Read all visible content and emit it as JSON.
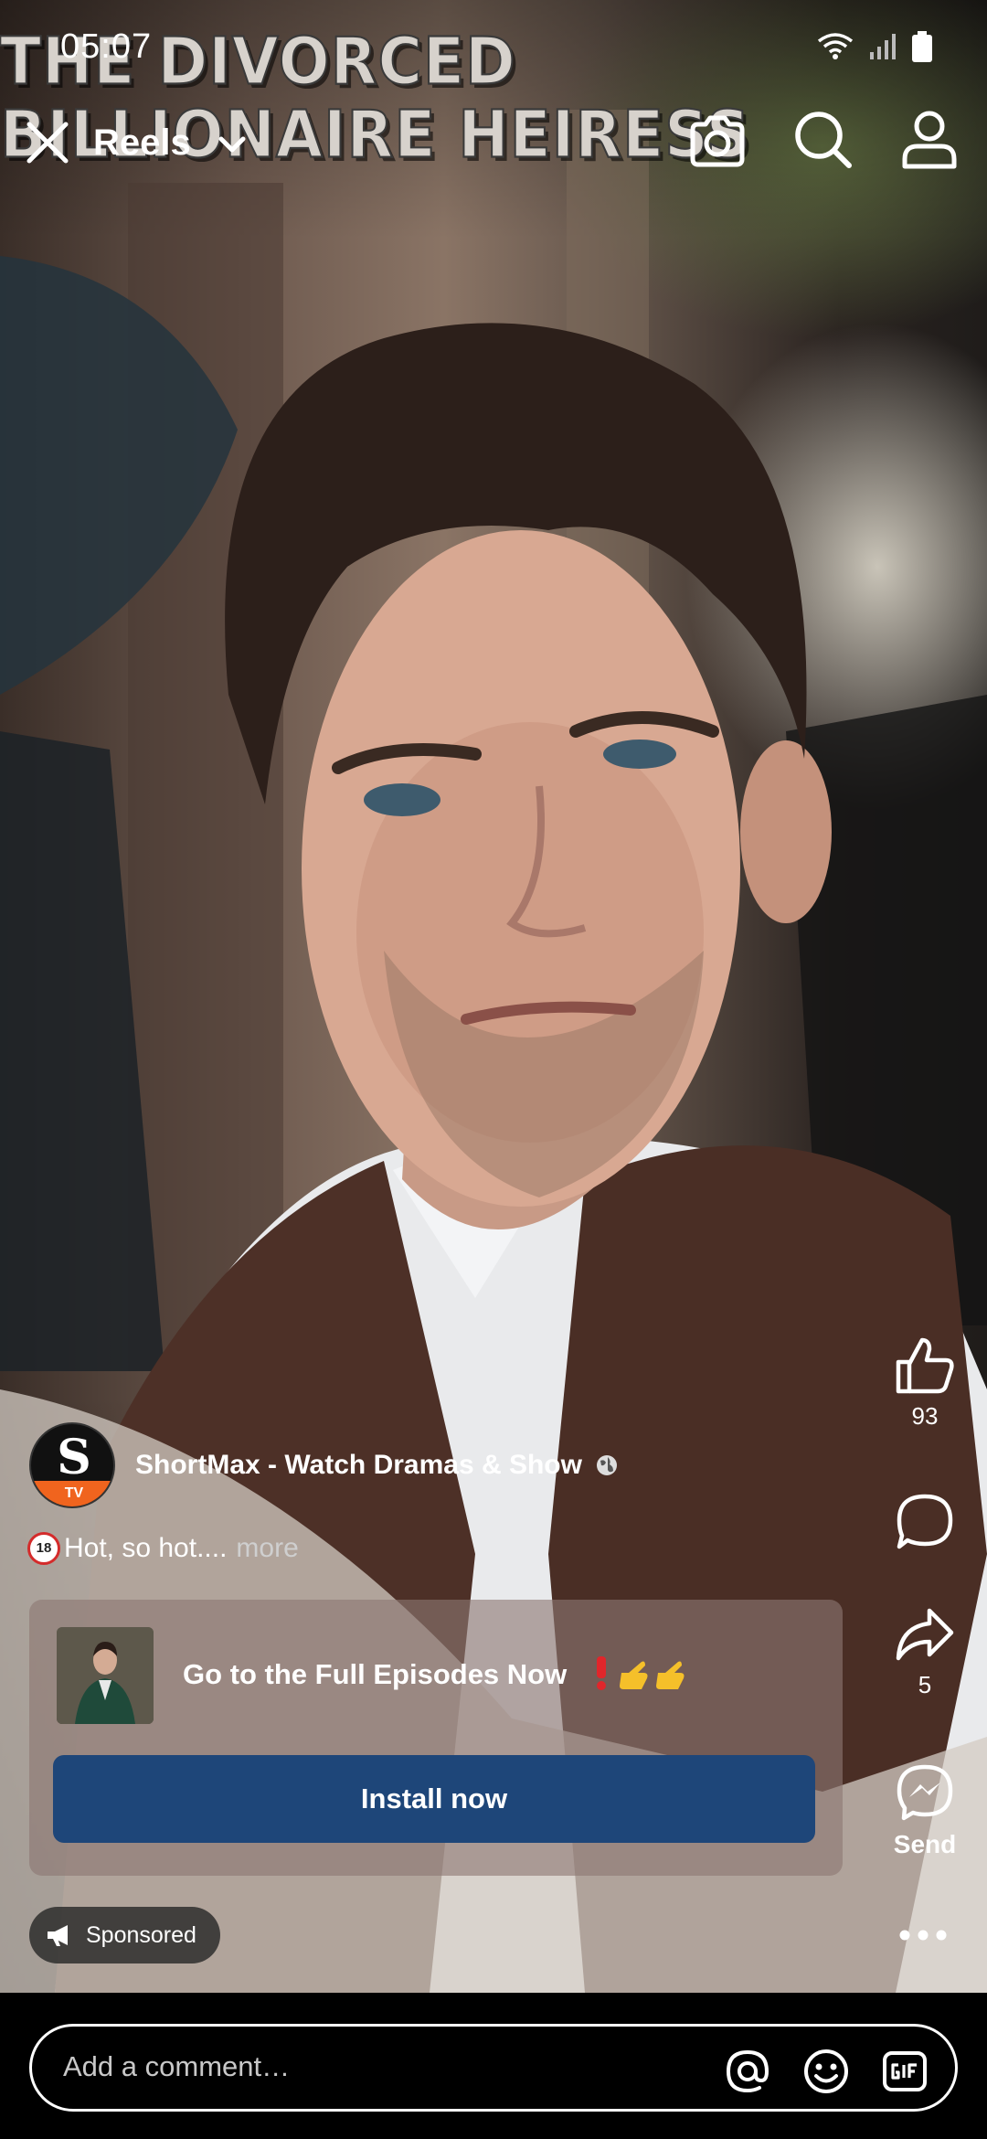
{
  "status_bar": {
    "time": "05:07"
  },
  "video": {
    "title_overlay": [
      "THE DIVORCED",
      "BILLIONAIRE HEIRESS"
    ]
  },
  "top_nav": {
    "title": "Reels"
  },
  "actions": {
    "like_count": "93",
    "share_count": "5",
    "send_label": "Send"
  },
  "author": {
    "avatar_letter": "S",
    "avatar_sub": "TV",
    "name": "ShortMax - Watch Dramas & Show"
  },
  "caption": {
    "badge": "18",
    "text": "Hot, so hot....",
    "more": "more"
  },
  "ad": {
    "text": "Go to the Full Episodes Now",
    "button_label": "Install now"
  },
  "sponsored": {
    "label": "Sponsored"
  },
  "comment": {
    "placeholder": "Add a comment…"
  },
  "colors": {
    "install_button": "#1e4679",
    "avatar_accent": "#f0641e",
    "ad_card": "#8c7873"
  }
}
